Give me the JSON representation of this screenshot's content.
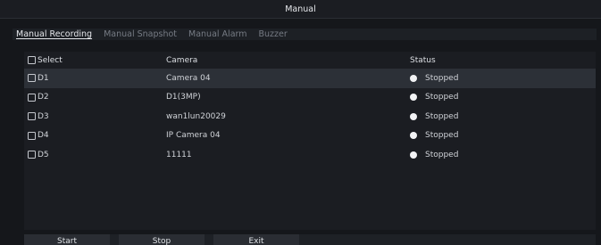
{
  "window": {
    "title": "Manual"
  },
  "tabs": [
    {
      "label": "Manual Recording",
      "active": true
    },
    {
      "label": "Manual Snapshot",
      "active": false
    },
    {
      "label": "Manual Alarm",
      "active": false
    },
    {
      "label": "Buzzer",
      "active": false
    }
  ],
  "table": {
    "headers": {
      "select": "Select",
      "camera": "Camera",
      "status": "Status"
    },
    "rows": [
      {
        "channel": "D1",
        "camera": "Camera 04",
        "status": "Stopped",
        "selected": true
      },
      {
        "channel": "D2",
        "camera": "D1(3MP)",
        "status": "Stopped",
        "selected": false
      },
      {
        "channel": "D3",
        "camera": "wan1lun20029",
        "status": "Stopped",
        "selected": false
      },
      {
        "channel": "D4",
        "camera": "IP Camera 04",
        "status": "Stopped",
        "selected": false
      },
      {
        "channel": "D5",
        "camera": "11111",
        "status": "Stopped",
        "selected": false
      }
    ]
  },
  "buttons": {
    "start": "Start",
    "stop": "Stop",
    "exit": "Exit"
  },
  "icons": {
    "checkbox": "checkbox-icon",
    "status": "status-dot-icon"
  },
  "colors": {
    "background": "#15171b",
    "selected_row": "#2c3037",
    "status_dot": "#f2f3f5"
  }
}
